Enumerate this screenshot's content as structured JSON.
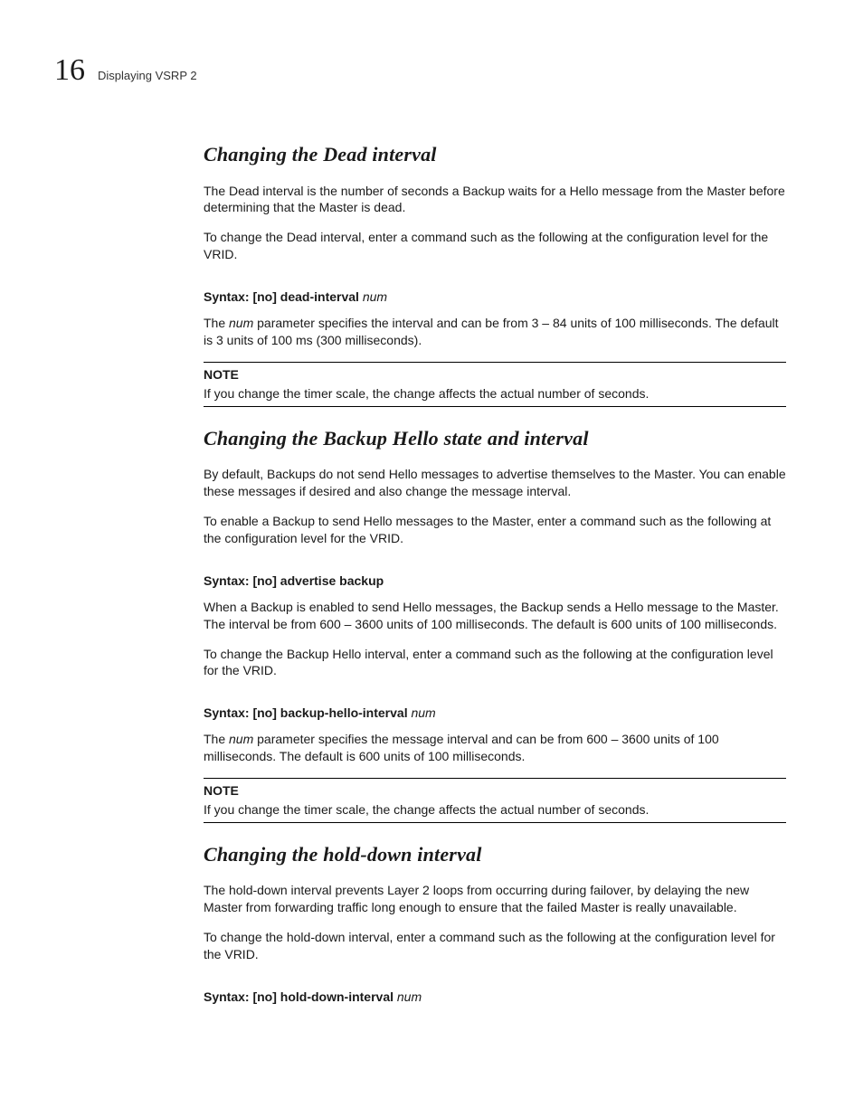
{
  "header": {
    "chapter_number": "16",
    "running_title": "Displaying VSRP 2"
  },
  "sections": {
    "dead": {
      "title": "Changing the Dead interval",
      "p1": "The Dead interval is the number of seconds a Backup waits for a Hello message from the Master before determining that the Master is dead.",
      "p2": "To change the Dead interval, enter a command such as the following at the configuration level for the VRID.",
      "syntax_label": "Syntax:",
      "syntax_cmd": " [no] dead-interval ",
      "syntax_arg": "num",
      "desc_pre": "The ",
      "desc_em": "num",
      "desc_post": " parameter specifies the interval and can be from 3 – 84 units of 100 milliseconds. The default is 3 units of 100 ms (300 milliseconds).",
      "note_label": "NOTE",
      "note_text": "If you change the timer scale, the change affects the actual number of seconds."
    },
    "backup": {
      "title": "Changing the Backup Hello state and interval",
      "p1": "By default, Backups do not send Hello messages to advertise themselves to the Master. You can enable these messages if desired and also change the message interval.",
      "p2": "To enable a Backup to send Hello messages to the Master, enter a command such as the following at the configuration level for the VRID.",
      "syntax1_label": "Syntax:",
      "syntax1_cmd": " [no] advertise backup",
      "p3": "When a Backup is enabled to send Hello messages, the Backup sends a Hello message to the Master. The interval be from 600 – 3600 units of 100 milliseconds. The default is 600 units of 100 milliseconds.",
      "p4": "To change the Backup Hello interval, enter a command such as the following at the configuration level for the VRID.",
      "syntax2_label": "Syntax:",
      "syntax2_cmd": " [no] backup-hello-interval ",
      "syntax2_arg": "num",
      "desc_pre": "The ",
      "desc_em": "num",
      "desc_post": " parameter specifies the message interval and can be from 600 – 3600 units of 100 milliseconds. The default is 600 units of 100 milliseconds.",
      "note_label": "NOTE",
      "note_text": "If you change the timer scale, the change affects the actual number of seconds."
    },
    "hold": {
      "title": "Changing the hold-down interval",
      "p1": "The hold-down interval prevents Layer 2 loops from occurring during failover, by delaying the new Master from forwarding traffic long enough to ensure that the failed Master is really unavailable.",
      "p2": "To change the hold-down interval, enter a command such as the following at the configuration level for the VRID.",
      "syntax_label": "Syntax:",
      "syntax_cmd": " [no] hold-down-interval ",
      "syntax_arg": "num"
    }
  }
}
